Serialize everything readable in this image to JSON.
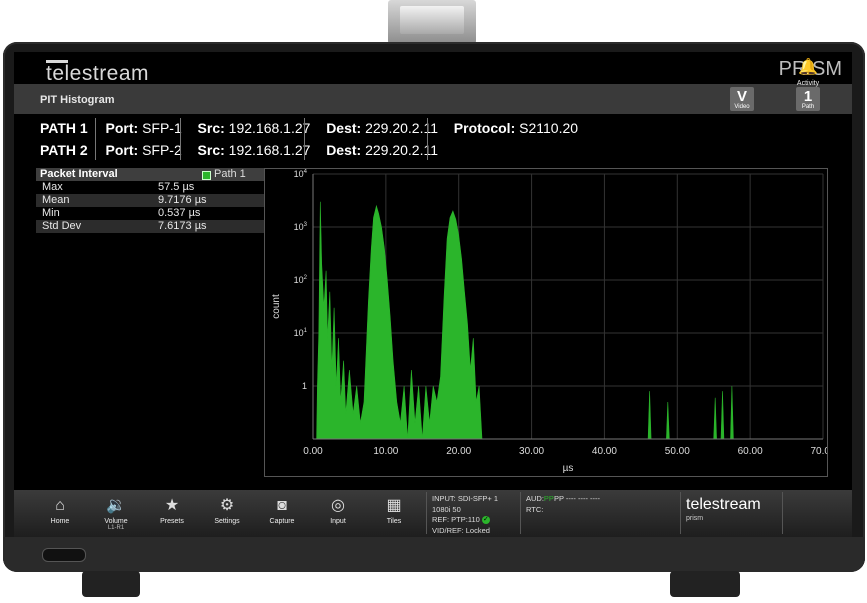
{
  "brand": {
    "logo": "telestream",
    "product": "PRISM"
  },
  "titlebar": {
    "title": "PIT Histogram",
    "buttons": [
      {
        "big": "V",
        "small": "Video"
      },
      {
        "big": "1",
        "small": "Path"
      }
    ]
  },
  "paths": [
    {
      "name": "PATH 1",
      "port_label": "Port:",
      "port": "SFP-1",
      "src_label": "Src:",
      "src": "192.168.1.27",
      "dest_label": "Dest:",
      "dest": "229.20.2.11",
      "protocol_label": "Protocol:",
      "protocol": "S2110.20"
    },
    {
      "name": "PATH 2",
      "port_label": "Port:",
      "port": "SFP-2",
      "src_label": "Src:",
      "src": "192.168.1.27",
      "dest_label": "Dest:",
      "dest": "229.20.2.11"
    }
  ],
  "stats": {
    "header": "Packet Interval",
    "legend": "Path 1",
    "legend_color": "#2bb52b",
    "rows": [
      {
        "label": "Max",
        "value": "57.5 µs"
      },
      {
        "label": "Mean",
        "value": "9.7176 µs"
      },
      {
        "label": "Min",
        "value": "0.537 µs"
      },
      {
        "label": "Std Dev",
        "value": "7.6173 µs"
      }
    ]
  },
  "chart_data": {
    "type": "area",
    "title": "",
    "xlabel": "µs",
    "ylabel": "count",
    "xlim": [
      0,
      70
    ],
    "xticks": [
      "0.00",
      "10.00",
      "20.00",
      "30.00",
      "40.00",
      "50.00",
      "60.00",
      "70.00"
    ],
    "yscale": "log",
    "yticks": [
      {
        "base": "1",
        "exp": ""
      },
      {
        "base": "10",
        "exp": "1"
      },
      {
        "base": "10",
        "exp": "2"
      },
      {
        "base": "10",
        "exp": "3"
      },
      {
        "base": "10",
        "exp": "4"
      }
    ],
    "grid": true,
    "series": [
      {
        "name": "Path 1",
        "color": "#2bb52b",
        "points": [
          [
            0.5,
            0.1
          ],
          [
            0.6,
            1
          ],
          [
            0.8,
            10
          ],
          [
            1.0,
            3000
          ],
          [
            1.2,
            200
          ],
          [
            1.5,
            30
          ],
          [
            1.8,
            150
          ],
          [
            2.0,
            8
          ],
          [
            2.3,
            60
          ],
          [
            2.6,
            2
          ],
          [
            2.9,
            30
          ],
          [
            3.2,
            1
          ],
          [
            3.5,
            8
          ],
          [
            3.8,
            0.5
          ],
          [
            4.2,
            3
          ],
          [
            4.5,
            0.3
          ],
          [
            5.0,
            2
          ],
          [
            5.5,
            0.3
          ],
          [
            6.0,
            1
          ],
          [
            6.5,
            0.2
          ],
          [
            7.0,
            0.5
          ],
          [
            7.6,
            40
          ],
          [
            8.0,
            400
          ],
          [
            8.3,
            1500
          ],
          [
            8.7,
            2500
          ],
          [
            9.0,
            1800
          ],
          [
            9.4,
            1000
          ],
          [
            9.8,
            400
          ],
          [
            10.2,
            100
          ],
          [
            10.6,
            20
          ],
          [
            11.0,
            3
          ],
          [
            11.5,
            0.5
          ],
          [
            12.0,
            0.2
          ],
          [
            12.5,
            1
          ],
          [
            13.0,
            0.1
          ],
          [
            13.5,
            2
          ],
          [
            14.0,
            0.2
          ],
          [
            14.5,
            1
          ],
          [
            15.0,
            0.1
          ],
          [
            15.5,
            1
          ],
          [
            16.0,
            0.2
          ],
          [
            16.5,
            1
          ],
          [
            17.0,
            0.5
          ],
          [
            17.5,
            1.5
          ],
          [
            18.0,
            50
          ],
          [
            18.4,
            600
          ],
          [
            18.8,
            1500
          ],
          [
            19.2,
            2000
          ],
          [
            19.6,
            1400
          ],
          [
            20.0,
            700
          ],
          [
            20.4,
            250
          ],
          [
            20.8,
            60
          ],
          [
            21.2,
            15
          ],
          [
            21.6,
            2
          ],
          [
            22.0,
            8
          ],
          [
            22.4,
            0.5
          ],
          [
            22.8,
            1
          ],
          [
            23.2,
            0.1
          ],
          [
            46.0,
            0.1
          ],
          [
            46.2,
            0.8
          ],
          [
            46.4,
            0.1
          ],
          [
            48.5,
            0.1
          ],
          [
            48.7,
            0.5
          ],
          [
            48.9,
            0.1
          ],
          [
            55.0,
            0.1
          ],
          [
            55.2,
            0.6
          ],
          [
            55.4,
            0.1
          ],
          [
            56.0,
            0.1
          ],
          [
            56.2,
            0.8
          ],
          [
            56.4,
            0.1
          ],
          [
            57.3,
            0.1
          ],
          [
            57.5,
            1
          ],
          [
            57.7,
            0.1
          ]
        ]
      }
    ]
  },
  "dock": {
    "buttons": [
      {
        "label": "Home",
        "sub": "",
        "icon": "home-icon",
        "glyph": "⌂"
      },
      {
        "label": "Volume",
        "sub": "L1-R1",
        "icon": "speaker-icon",
        "glyph": "🔉"
      },
      {
        "label": "Presets",
        "sub": "",
        "icon": "star-icon",
        "glyph": "★"
      },
      {
        "label": "Settings",
        "sub": "",
        "icon": "gear-icon",
        "glyph": "⚙"
      },
      {
        "label": "Capture",
        "sub": "",
        "icon": "camera-icon",
        "glyph": "◙"
      },
      {
        "label": "Input",
        "sub": "",
        "icon": "input-icon",
        "glyph": "◎"
      },
      {
        "label": "Tiles",
        "sub": "",
        "icon": "tiles-icon",
        "glyph": "▦"
      }
    ],
    "status": {
      "input": "INPUT: SDI-SFP+ 1",
      "format": "1080i 50",
      "ref": "REF: PTP:110",
      "vidref": "VID/REF: Locked"
    },
    "aud": {
      "label": "AUD:",
      "green": "PP",
      "rest": "PP ---- ---- ----",
      "rtc": "RTC:"
    },
    "logo": "telestream",
    "logo_sub": "prism",
    "activity": {
      "label": "Activity",
      "icon": "bell-icon",
      "glyph": "🔔"
    }
  }
}
